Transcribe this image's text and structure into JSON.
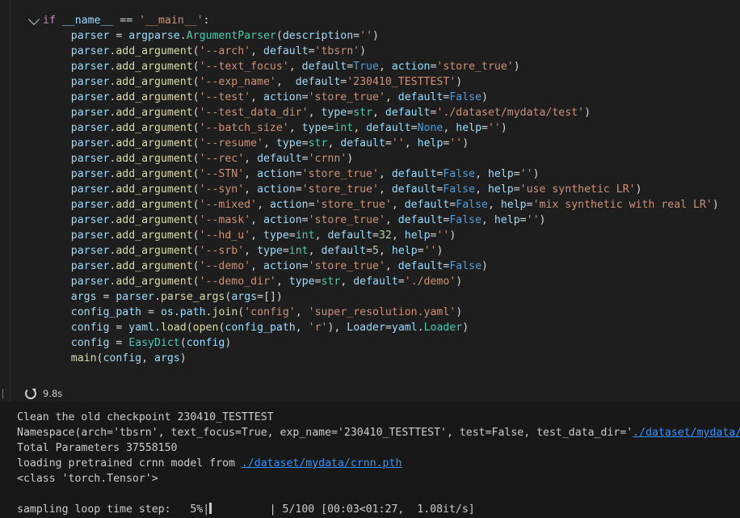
{
  "code_lines": [
    [
      [
        "kw2",
        "if "
      ],
      [
        "var",
        "__name__"
      ],
      [
        "op",
        " == "
      ],
      [
        "str",
        "'__main__'"
      ],
      [
        "op",
        ":"
      ]
    ],
    [
      [
        "op",
        "    "
      ],
      [
        "var",
        "parser"
      ],
      [
        "op",
        " = "
      ],
      [
        "var",
        "argparse"
      ],
      [
        "op",
        "."
      ],
      [
        "cls",
        "ArgumentParser"
      ],
      [
        "op",
        "("
      ],
      [
        "var",
        "description"
      ],
      [
        "op",
        "="
      ],
      [
        "str",
        "''"
      ],
      [
        "op",
        ")"
      ]
    ],
    [
      [
        "op",
        "    "
      ],
      [
        "var",
        "parser"
      ],
      [
        "op",
        "."
      ],
      [
        "fn",
        "add_argument"
      ],
      [
        "op",
        "("
      ],
      [
        "str",
        "'--arch'"
      ],
      [
        "op",
        ", "
      ],
      [
        "var",
        "default"
      ],
      [
        "op",
        "="
      ],
      [
        "str",
        "'tbsrn'"
      ],
      [
        "op",
        ")"
      ]
    ],
    [
      [
        "op",
        "    "
      ],
      [
        "var",
        "parser"
      ],
      [
        "op",
        "."
      ],
      [
        "fn",
        "add_argument"
      ],
      [
        "op",
        "("
      ],
      [
        "str",
        "'--text_focus'"
      ],
      [
        "op",
        ", "
      ],
      [
        "var",
        "default"
      ],
      [
        "op",
        "="
      ],
      [
        "kw",
        "True"
      ],
      [
        "op",
        ", "
      ],
      [
        "var",
        "action"
      ],
      [
        "op",
        "="
      ],
      [
        "str",
        "'store_true'"
      ],
      [
        "op",
        ")"
      ]
    ],
    [
      [
        "op",
        "    "
      ],
      [
        "var",
        "parser"
      ],
      [
        "op",
        "."
      ],
      [
        "fn",
        "add_argument"
      ],
      [
        "op",
        "("
      ],
      [
        "str",
        "'--exp_name'"
      ],
      [
        "op",
        ",  "
      ],
      [
        "var",
        "default"
      ],
      [
        "op",
        "="
      ],
      [
        "str",
        "'230410_TESTTEST'"
      ],
      [
        "op",
        ")"
      ]
    ],
    [
      [
        "op",
        "    "
      ],
      [
        "var",
        "parser"
      ],
      [
        "op",
        "."
      ],
      [
        "fn",
        "add_argument"
      ],
      [
        "op",
        "("
      ],
      [
        "str",
        "'--test'"
      ],
      [
        "op",
        ", "
      ],
      [
        "var",
        "action"
      ],
      [
        "op",
        "="
      ],
      [
        "str",
        "'store_true'"
      ],
      [
        "op",
        ", "
      ],
      [
        "var",
        "default"
      ],
      [
        "op",
        "="
      ],
      [
        "kw",
        "False"
      ],
      [
        "op",
        ")"
      ]
    ],
    [
      [
        "op",
        "    "
      ],
      [
        "var",
        "parser"
      ],
      [
        "op",
        "."
      ],
      [
        "fn",
        "add_argument"
      ],
      [
        "op",
        "("
      ],
      [
        "str",
        "'--test_data_dir'"
      ],
      [
        "op",
        ", "
      ],
      [
        "var",
        "type"
      ],
      [
        "op",
        "="
      ],
      [
        "cls",
        "str"
      ],
      [
        "op",
        ", "
      ],
      [
        "var",
        "default"
      ],
      [
        "op",
        "="
      ],
      [
        "str",
        "'./dataset/mydata/test'"
      ],
      [
        "op",
        ")"
      ]
    ],
    [
      [
        "op",
        "    "
      ],
      [
        "var",
        "parser"
      ],
      [
        "op",
        "."
      ],
      [
        "fn",
        "add_argument"
      ],
      [
        "op",
        "("
      ],
      [
        "str",
        "'--batch_size'"
      ],
      [
        "op",
        ", "
      ],
      [
        "var",
        "type"
      ],
      [
        "op",
        "="
      ],
      [
        "cls",
        "int"
      ],
      [
        "op",
        ", "
      ],
      [
        "var",
        "default"
      ],
      [
        "op",
        "="
      ],
      [
        "kw",
        "None"
      ],
      [
        "op",
        ", "
      ],
      [
        "var",
        "help"
      ],
      [
        "op",
        "="
      ],
      [
        "str",
        "''"
      ],
      [
        "op",
        ")"
      ]
    ],
    [
      [
        "op",
        "    "
      ],
      [
        "var",
        "parser"
      ],
      [
        "op",
        "."
      ],
      [
        "fn",
        "add_argument"
      ],
      [
        "op",
        "("
      ],
      [
        "str",
        "'--resume'"
      ],
      [
        "op",
        ", "
      ],
      [
        "var",
        "type"
      ],
      [
        "op",
        "="
      ],
      [
        "cls",
        "str"
      ],
      [
        "op",
        ", "
      ],
      [
        "var",
        "default"
      ],
      [
        "op",
        "="
      ],
      [
        "str",
        "''"
      ],
      [
        "op",
        ", "
      ],
      [
        "var",
        "help"
      ],
      [
        "op",
        "="
      ],
      [
        "str",
        "''"
      ],
      [
        "op",
        ")"
      ]
    ],
    [
      [
        "op",
        "    "
      ],
      [
        "var",
        "parser"
      ],
      [
        "op",
        "."
      ],
      [
        "fn",
        "add_argument"
      ],
      [
        "op",
        "("
      ],
      [
        "str",
        "'--rec'"
      ],
      [
        "op",
        ", "
      ],
      [
        "var",
        "default"
      ],
      [
        "op",
        "="
      ],
      [
        "str",
        "'crnn'"
      ],
      [
        "op",
        ")"
      ]
    ],
    [
      [
        "op",
        "    "
      ],
      [
        "var",
        "parser"
      ],
      [
        "op",
        "."
      ],
      [
        "fn",
        "add_argument"
      ],
      [
        "op",
        "("
      ],
      [
        "str",
        "'--STN'"
      ],
      [
        "op",
        ", "
      ],
      [
        "var",
        "action"
      ],
      [
        "op",
        "="
      ],
      [
        "str",
        "'store_true'"
      ],
      [
        "op",
        ", "
      ],
      [
        "var",
        "default"
      ],
      [
        "op",
        "="
      ],
      [
        "kw",
        "False"
      ],
      [
        "op",
        ", "
      ],
      [
        "var",
        "help"
      ],
      [
        "op",
        "="
      ],
      [
        "str",
        "''"
      ],
      [
        "op",
        ")"
      ]
    ],
    [
      [
        "op",
        "    "
      ],
      [
        "var",
        "parser"
      ],
      [
        "op",
        "."
      ],
      [
        "fn",
        "add_argument"
      ],
      [
        "op",
        "("
      ],
      [
        "str",
        "'--syn'"
      ],
      [
        "op",
        ", "
      ],
      [
        "var",
        "action"
      ],
      [
        "op",
        "="
      ],
      [
        "str",
        "'store_true'"
      ],
      [
        "op",
        ", "
      ],
      [
        "var",
        "default"
      ],
      [
        "op",
        "="
      ],
      [
        "kw",
        "False"
      ],
      [
        "op",
        ", "
      ],
      [
        "var",
        "help"
      ],
      [
        "op",
        "="
      ],
      [
        "str",
        "'use synthetic LR'"
      ],
      [
        "op",
        ")"
      ]
    ],
    [
      [
        "op",
        "    "
      ],
      [
        "var",
        "parser"
      ],
      [
        "op",
        "."
      ],
      [
        "fn",
        "add_argument"
      ],
      [
        "op",
        "("
      ],
      [
        "str",
        "'--mixed'"
      ],
      [
        "op",
        ", "
      ],
      [
        "var",
        "action"
      ],
      [
        "op",
        "="
      ],
      [
        "str",
        "'store_true'"
      ],
      [
        "op",
        ", "
      ],
      [
        "var",
        "default"
      ],
      [
        "op",
        "="
      ],
      [
        "kw",
        "False"
      ],
      [
        "op",
        ", "
      ],
      [
        "var",
        "help"
      ],
      [
        "op",
        "="
      ],
      [
        "str",
        "'mix synthetic with real LR'"
      ],
      [
        "op",
        ")"
      ]
    ],
    [
      [
        "op",
        "    "
      ],
      [
        "var",
        "parser"
      ],
      [
        "op",
        "."
      ],
      [
        "fn",
        "add_argument"
      ],
      [
        "op",
        "("
      ],
      [
        "str",
        "'--mask'"
      ],
      [
        "op",
        ", "
      ],
      [
        "var",
        "action"
      ],
      [
        "op",
        "="
      ],
      [
        "str",
        "'store_true'"
      ],
      [
        "op",
        ", "
      ],
      [
        "var",
        "default"
      ],
      [
        "op",
        "="
      ],
      [
        "kw",
        "False"
      ],
      [
        "op",
        ", "
      ],
      [
        "var",
        "help"
      ],
      [
        "op",
        "="
      ],
      [
        "str",
        "''"
      ],
      [
        "op",
        ")"
      ]
    ],
    [
      [
        "op",
        "    "
      ],
      [
        "var",
        "parser"
      ],
      [
        "op",
        "."
      ],
      [
        "fn",
        "add_argument"
      ],
      [
        "op",
        "("
      ],
      [
        "str",
        "'--hd_u'"
      ],
      [
        "op",
        ", "
      ],
      [
        "var",
        "type"
      ],
      [
        "op",
        "="
      ],
      [
        "cls",
        "int"
      ],
      [
        "op",
        ", "
      ],
      [
        "var",
        "default"
      ],
      [
        "op",
        "="
      ],
      [
        "num",
        "32"
      ],
      [
        "op",
        ", "
      ],
      [
        "var",
        "help"
      ],
      [
        "op",
        "="
      ],
      [
        "str",
        "''"
      ],
      [
        "op",
        ")"
      ]
    ],
    [
      [
        "op",
        "    "
      ],
      [
        "var",
        "parser"
      ],
      [
        "op",
        "."
      ],
      [
        "fn",
        "add_argument"
      ],
      [
        "op",
        "("
      ],
      [
        "str",
        "'--srb'"
      ],
      [
        "op",
        ", "
      ],
      [
        "var",
        "type"
      ],
      [
        "op",
        "="
      ],
      [
        "cls",
        "int"
      ],
      [
        "op",
        ", "
      ],
      [
        "var",
        "default"
      ],
      [
        "op",
        "="
      ],
      [
        "num",
        "5"
      ],
      [
        "op",
        ", "
      ],
      [
        "var",
        "help"
      ],
      [
        "op",
        "="
      ],
      [
        "str",
        "''"
      ],
      [
        "op",
        ")"
      ]
    ],
    [
      [
        "op",
        "    "
      ],
      [
        "var",
        "parser"
      ],
      [
        "op",
        "."
      ],
      [
        "fn",
        "add_argument"
      ],
      [
        "op",
        "("
      ],
      [
        "str",
        "'--demo'"
      ],
      [
        "op",
        ", "
      ],
      [
        "var",
        "action"
      ],
      [
        "op",
        "="
      ],
      [
        "str",
        "'store_true'"
      ],
      [
        "op",
        ", "
      ],
      [
        "var",
        "default"
      ],
      [
        "op",
        "="
      ],
      [
        "kw",
        "False"
      ],
      [
        "op",
        ")"
      ]
    ],
    [
      [
        "op",
        "    "
      ],
      [
        "var",
        "parser"
      ],
      [
        "op",
        "."
      ],
      [
        "fn",
        "add_argument"
      ],
      [
        "op",
        "("
      ],
      [
        "str",
        "'--demo_dir'"
      ],
      [
        "op",
        ", "
      ],
      [
        "var",
        "type"
      ],
      [
        "op",
        "="
      ],
      [
        "cls",
        "str"
      ],
      [
        "op",
        ", "
      ],
      [
        "var",
        "default"
      ],
      [
        "op",
        "="
      ],
      [
        "str",
        "'./demo'"
      ],
      [
        "op",
        ")"
      ]
    ],
    [
      [
        "op",
        "    "
      ],
      [
        "var",
        "args"
      ],
      [
        "op",
        " = "
      ],
      [
        "var",
        "parser"
      ],
      [
        "op",
        "."
      ],
      [
        "fn",
        "parse_args"
      ],
      [
        "op",
        "("
      ],
      [
        "var",
        "args"
      ],
      [
        "op",
        "=[])"
      ]
    ],
    [
      [
        "op",
        "    "
      ],
      [
        "var",
        "config_path"
      ],
      [
        "op",
        " = "
      ],
      [
        "var",
        "os"
      ],
      [
        "op",
        "."
      ],
      [
        "var",
        "path"
      ],
      [
        "op",
        "."
      ],
      [
        "fn",
        "join"
      ],
      [
        "op",
        "("
      ],
      [
        "str",
        "'config'"
      ],
      [
        "op",
        ", "
      ],
      [
        "str",
        "'super_resolution.yaml'"
      ],
      [
        "op",
        ")"
      ]
    ],
    [
      [
        "op",
        "    "
      ],
      [
        "var",
        "config"
      ],
      [
        "op",
        " = "
      ],
      [
        "var",
        "yaml"
      ],
      [
        "op",
        "."
      ],
      [
        "fn",
        "load"
      ],
      [
        "op",
        "("
      ],
      [
        "fn",
        "open"
      ],
      [
        "op",
        "("
      ],
      [
        "var",
        "config_path"
      ],
      [
        "op",
        ", "
      ],
      [
        "str",
        "'r'"
      ],
      [
        "op",
        "), "
      ],
      [
        "var",
        "Loader"
      ],
      [
        "op",
        "="
      ],
      [
        "var",
        "yaml"
      ],
      [
        "op",
        "."
      ],
      [
        "cls",
        "Loader"
      ],
      [
        "op",
        ")"
      ]
    ],
    [
      [
        "op",
        "    "
      ],
      [
        "var",
        "config"
      ],
      [
        "op",
        " = "
      ],
      [
        "cls",
        "EasyDict"
      ],
      [
        "op",
        "("
      ],
      [
        "var",
        "config"
      ],
      [
        "op",
        ")"
      ]
    ],
    [
      [
        "op",
        "    "
      ],
      [
        "fn",
        "main"
      ],
      [
        "op",
        "("
      ],
      [
        "var",
        "config"
      ],
      [
        "op",
        ", "
      ],
      [
        "var",
        "args"
      ],
      [
        "op",
        ")"
      ]
    ]
  ],
  "status": {
    "duration": "9.8s",
    "icon": "refresh-icon"
  },
  "output_lines": [
    [
      [
        "t",
        "Clean the old checkpoint 230410_TESTTEST"
      ]
    ],
    [
      [
        "t",
        "Namespace(arch='tbsrn', text_focus=True, exp_name='230410_TESTTEST', test=False, test_data_dir='"
      ],
      [
        "link",
        "./dataset/mydata/test"
      ]
    ],
    [
      [
        "t",
        "Total Parameters 37558150"
      ]
    ],
    [
      [
        "t",
        "loading pretrained crnn model from "
      ],
      [
        "link",
        "./dataset/mydata/crnn.pth"
      ]
    ],
    [
      [
        "t",
        "<class 'torch.Tensor'>"
      ]
    ],
    [
      [
        "t",
        ""
      ]
    ],
    [
      [
        "t",
        "sampling loop time step:   5%|"
      ],
      [
        "bar",
        ""
      ],
      [
        "t",
        "         | 5/100 [00:03<01:27,  1.08it/s]"
      ]
    ]
  ]
}
